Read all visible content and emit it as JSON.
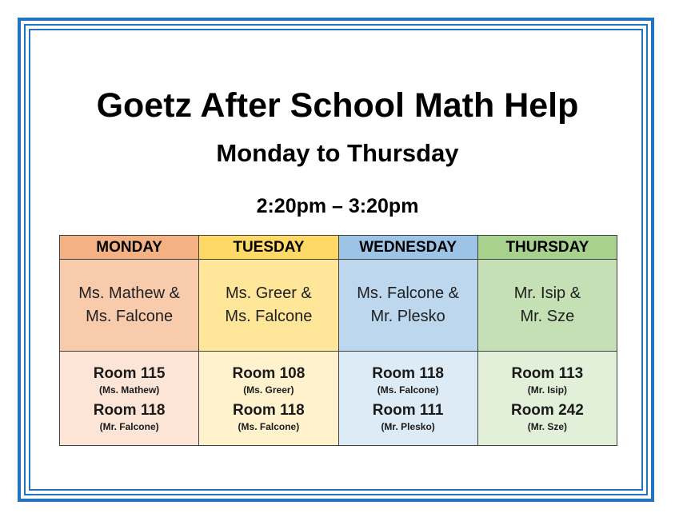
{
  "title": "Goetz After School Math Help",
  "subtitle": "Monday to Thursday",
  "time": "2:20pm – 3:20pm",
  "colors": {
    "border": "#1f73c0",
    "monday_header": "#f4b183",
    "monday_teachers": "#f8cbad",
    "monday_rooms": "#fce4d6",
    "tuesday_header": "#ffd966",
    "tuesday_teachers": "#ffe699",
    "tuesday_rooms": "#fff2cc",
    "wednesday_header": "#9dc3e6",
    "wednesday_teachers": "#bdd7ee",
    "wednesday_rooms": "#ddebf7",
    "thursday_header": "#a9d18e",
    "thursday_teachers": "#c5e0b4",
    "thursday_rooms": "#e2f0d9"
  },
  "days": [
    {
      "name": "MONDAY",
      "teachers": [
        "Ms. Mathew &",
        "Ms. Falcone"
      ],
      "rooms": [
        {
          "room": "Room 115",
          "teacher": "(Ms. Mathew)"
        },
        {
          "room": "Room 118",
          "teacher": "(Mr. Falcone)"
        }
      ]
    },
    {
      "name": "TUESDAY",
      "teachers": [
        "Ms. Greer &",
        "Ms. Falcone"
      ],
      "rooms": [
        {
          "room": "Room 108",
          "teacher": "(Ms. Greer)"
        },
        {
          "room": "Room 118",
          "teacher": "(Ms. Falcone)"
        }
      ]
    },
    {
      "name": "WEDNESDAY",
      "teachers": [
        "Ms. Falcone &",
        "Mr. Plesko"
      ],
      "rooms": [
        {
          "room": "Room 118",
          "teacher": "(Ms. Falcone)"
        },
        {
          "room": "Room 111",
          "teacher": "(Mr. Plesko)"
        }
      ]
    },
    {
      "name": "THURSDAY",
      "teachers": [
        "Mr. Isip &",
        "Mr. Sze"
      ],
      "rooms": [
        {
          "room": "Room 113",
          "teacher": "(Mr. Isip)"
        },
        {
          "room": "Room 242",
          "teacher": "(Mr. Sze)"
        }
      ]
    }
  ]
}
